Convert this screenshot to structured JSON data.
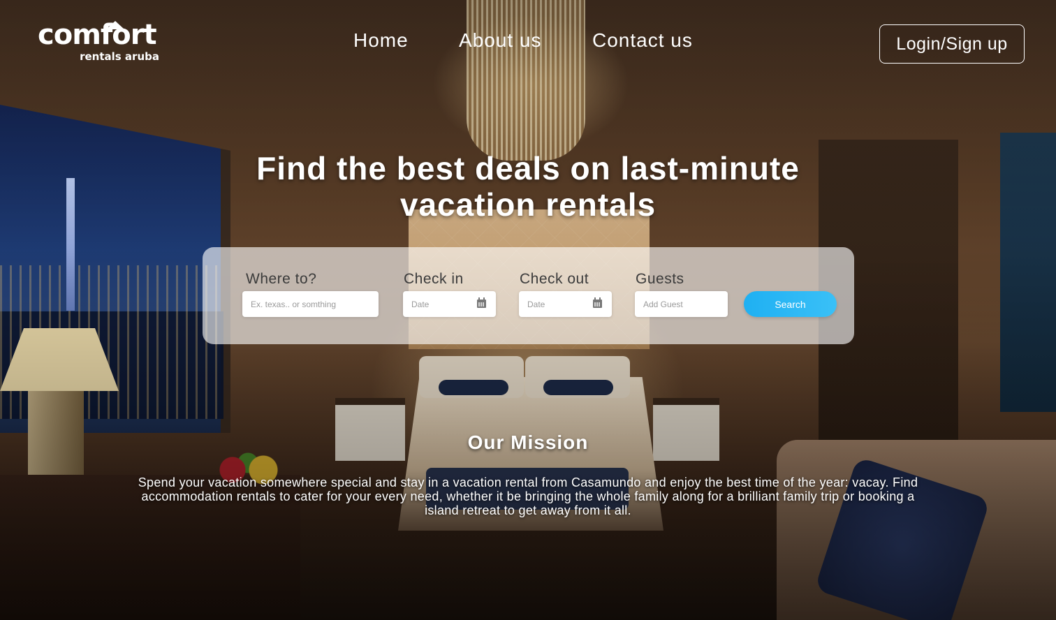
{
  "brand": {
    "logo_main": "comfort",
    "logo_sub": "rentals aruba"
  },
  "nav": {
    "items": [
      {
        "label": "Home"
      },
      {
        "label": "About us"
      },
      {
        "label": "Contact us"
      }
    ],
    "login_label": "Login/Sign up"
  },
  "hero": {
    "headline_line1": "Find the best deals on last-minute",
    "headline_line2": "vacation rentals"
  },
  "search": {
    "where_label": "Where to?",
    "where_placeholder": "Ex. texas.. or somthing",
    "checkin_label": "Check in",
    "checkin_placeholder": "Date",
    "checkout_label": "Check out",
    "checkout_placeholder": "Date",
    "guests_label": "Guests",
    "guests_placeholder": "Add Guest",
    "button_label": "Search",
    "accent_color": "#1fb0f2"
  },
  "mission": {
    "title": "Our Mission",
    "text": "Spend your vacation somewhere special and stay in a vacation rental from Casamundo and enjoy the best time of the year: vacay. Find accommodation rentals to cater for your every need, whether it be bringing the whole family along for a brilliant family trip or booking a island retreat to get away from it all."
  },
  "icons": {
    "calendar": "calendar-icon"
  }
}
